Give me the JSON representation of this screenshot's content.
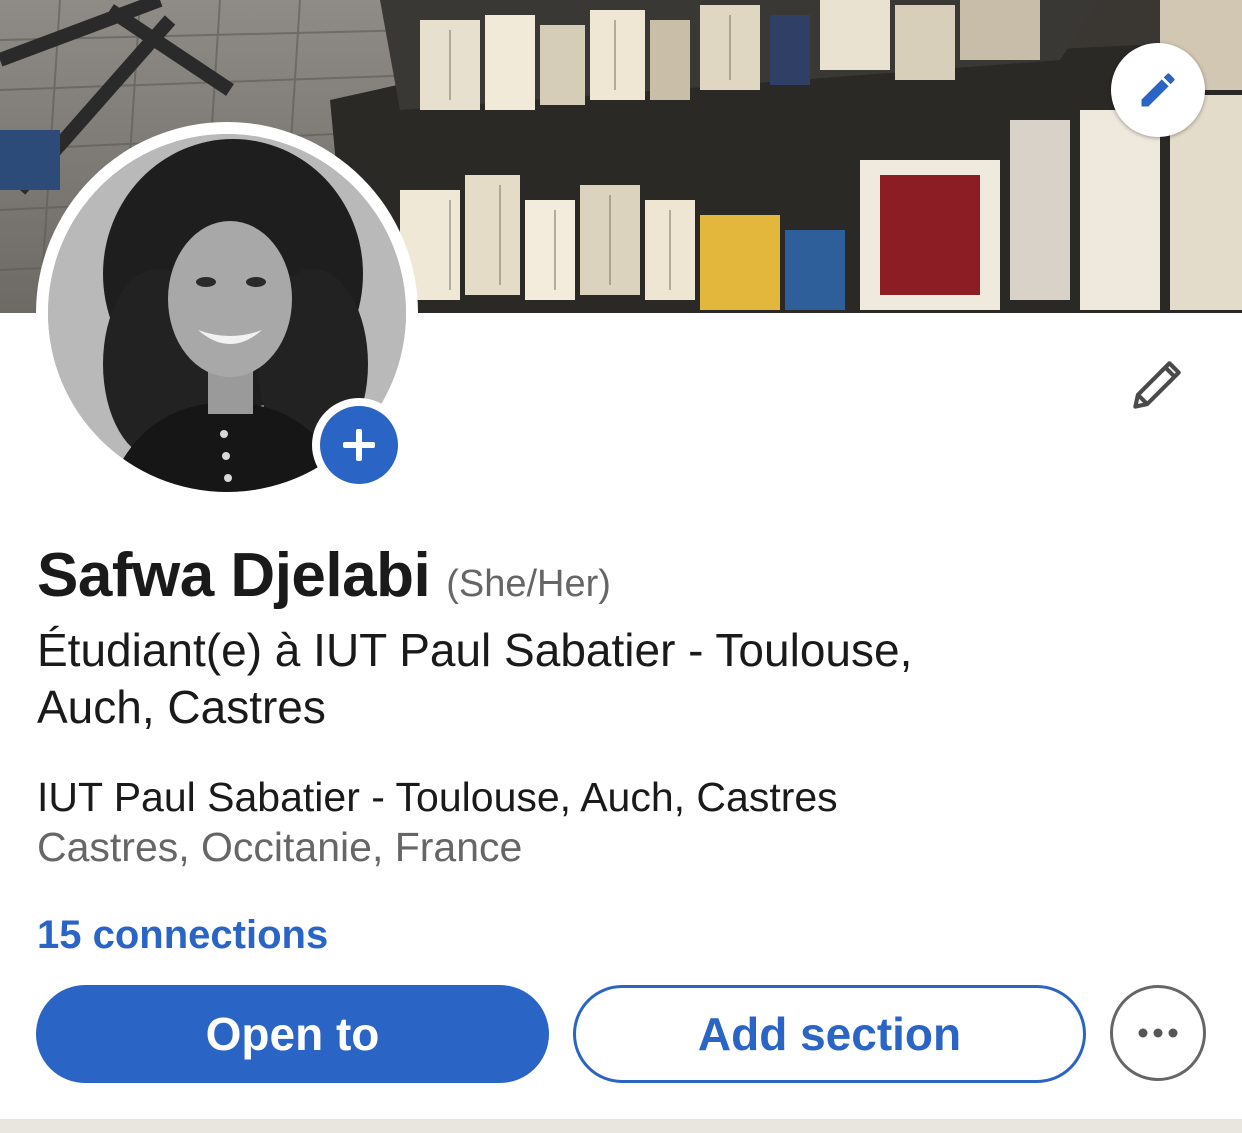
{
  "profile": {
    "name": "Safwa Djelabi",
    "pronouns": "(She/Her)",
    "headline": "Étudiant(e) à IUT Paul Sabatier - Toulouse, Auch, Castres",
    "education": "IUT Paul Sabatier - Toulouse, Auch, Castres",
    "location": "Castres, Occitanie, France",
    "connections": "15 connections"
  },
  "actions": {
    "open_to": "Open to",
    "add_section": "Add section"
  },
  "icons": {
    "cover_edit": "pencil-icon",
    "intro_edit": "pencil-icon",
    "avatar_add": "plus-icon",
    "more": "ellipsis-icon"
  },
  "colors": {
    "accent": "#2a64c5",
    "text_primary": "#1a1a1a",
    "text_secondary": "#666666",
    "background": "#ffffff"
  }
}
